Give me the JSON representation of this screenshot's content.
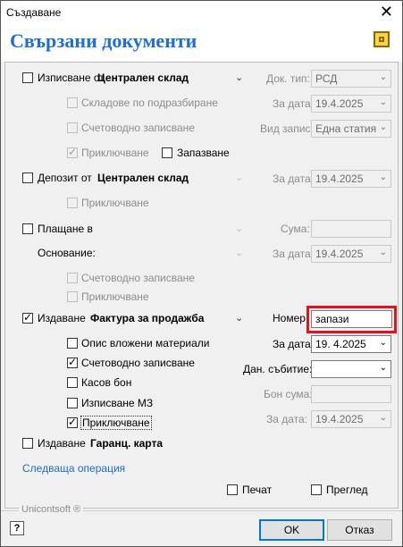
{
  "window": {
    "title": "Създаване"
  },
  "header": {
    "title": "Свързани документи"
  },
  "issue": {
    "label": "Изписване от",
    "warehouse": "Централен склад",
    "default_warehouses": "Складове по подразбиране",
    "accounting": "Счетоводно записване",
    "complete": "Приключване",
    "save": "Запазване"
  },
  "deposit": {
    "label": "Депозит от",
    "warehouse": "Централен склад",
    "complete": "Приключване"
  },
  "payment": {
    "label": "Плащане в",
    "reason": "Основание:",
    "accounting": "Счетоводно записване",
    "complete": "Приключване"
  },
  "invoice": {
    "label": "Издаване",
    "doc": "Фактура за продажба",
    "materials": "Опис вложени материали",
    "accounting": "Счетоводно записване",
    "cash_receipt": "Касов бон",
    "issue_mz": "Изписване МЗ",
    "complete": "Приключване"
  },
  "warranty": {
    "label": "Издаване",
    "doc": "Гаранц. карта"
  },
  "next_op": "Следваща операция",
  "right": {
    "doc_type_label": "Док. тип:",
    "doc_type_value": "РСД",
    "date_label": "За дата:",
    "date_value": "19.4.2025",
    "entry_type_label": "Вид запис:",
    "entry_type_value": "Една статия",
    "amount_label": "Сума:",
    "number_label": "Номер",
    "number_value": "запази",
    "invoice_date_value": "19.  4.2025",
    "event_date_label": "Дан. събитие:",
    "receipt_amount_label": "Бон сума:"
  },
  "footer": {
    "brand": "Unicontsoft ®",
    "print": "Печат",
    "preview": "Преглед",
    "ok": "OK",
    "cancel": "Отказ",
    "help": "?"
  },
  "colors": {
    "accent": "#1e6fd0",
    "highlight": "#e0141e",
    "link": "#1a6ec7"
  }
}
